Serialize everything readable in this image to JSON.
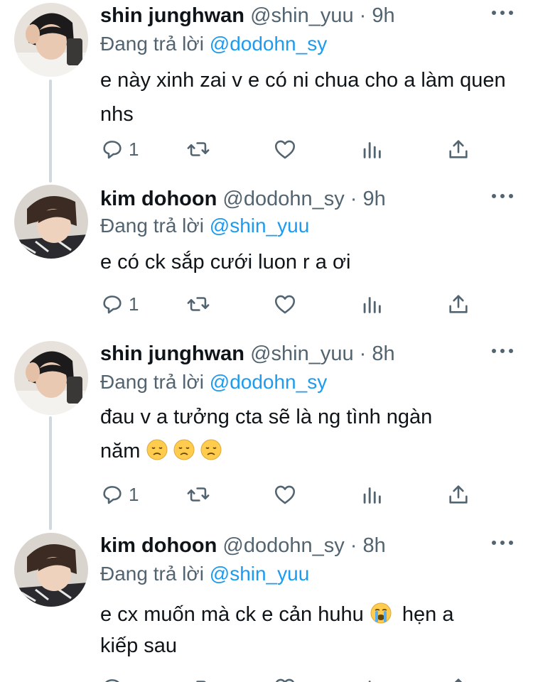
{
  "reply_prefix": "Đang trả lời",
  "tweets": [
    {
      "name": "shin junghwan",
      "handle": "@shin_yuu",
      "time": "9h",
      "reply_to": "@dodohn_sy",
      "text": "e này xinh zai v e có ni chua cho a làm quen nhs",
      "reply_count": "1"
    },
    {
      "name": "kim dohoon",
      "handle": "@dodohn_sy",
      "time": "9h",
      "reply_to": "@shin_yuu",
      "text": "e có ck sắp cưới luon r a ơi",
      "reply_count": "1"
    },
    {
      "name": "shin junghwan",
      "handle": "@shin_yuu",
      "time": "8h",
      "reply_to": "@dodohn_sy",
      "text_line1": "đau v a tưởng cta sẽ là ng tình ngàn",
      "text_line2": "năm",
      "emoji": "disappointed-face",
      "reply_count": "1"
    },
    {
      "name": "kim dohoon",
      "handle": "@dodohn_sy",
      "time": "8h",
      "reply_to": "@shin_yuu",
      "text_before": "e cx muốn mà ck e cản huhu",
      "emoji": "loudly-crying-face",
      "text_after": " hẹn a",
      "text_line2": "kiếp sau"
    }
  ],
  "separator": "·",
  "colors": {
    "name": "#0f1419",
    "secondary": "#536471",
    "mention": "#1d9bf0",
    "thread_line": "#cfd9de"
  }
}
